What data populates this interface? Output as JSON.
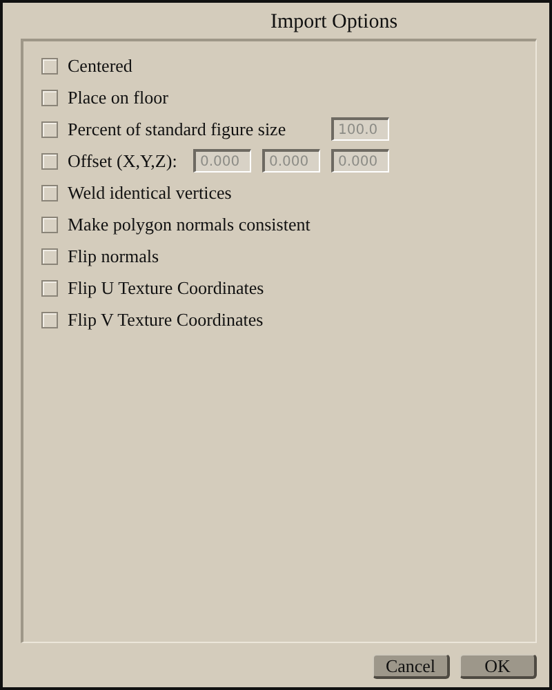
{
  "window": {
    "title": "Import Options"
  },
  "options": [
    {
      "label": "Centered",
      "checked": false
    },
    {
      "label": "Place on floor",
      "checked": false
    },
    {
      "label": "Percent of standard figure size",
      "checked": false,
      "fields": [
        {
          "value": "100.0",
          "disabled": true
        }
      ]
    },
    {
      "label": "Offset (X,Y,Z):",
      "checked": false,
      "fields": [
        {
          "value": "0.000",
          "disabled": true
        },
        {
          "value": "0.000",
          "disabled": true
        },
        {
          "value": "0.000",
          "disabled": true
        }
      ]
    },
    {
      "label": "Weld identical vertices",
      "checked": false
    },
    {
      "label": "Make polygon normals consistent",
      "checked": false
    },
    {
      "label": "Flip normals",
      "checked": false
    },
    {
      "label": "Flip U Texture Coordinates",
      "checked": false
    },
    {
      "label": "Flip V Texture Coordinates",
      "checked": false
    }
  ],
  "buttons": [
    "Cancel",
    "OK"
  ]
}
